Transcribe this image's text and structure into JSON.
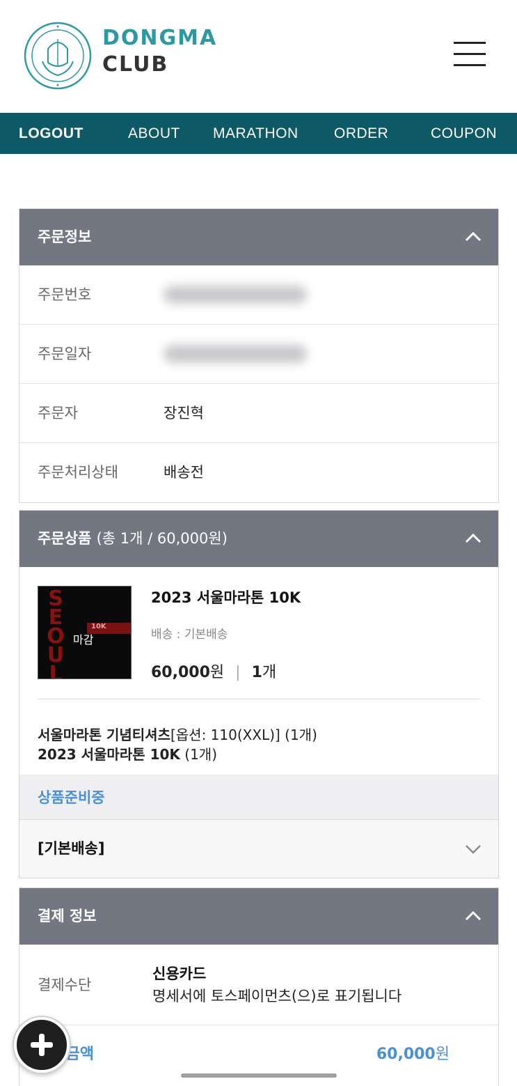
{
  "header": {
    "brand_line1": "DONGMA",
    "brand_line2": "CLUB",
    "logo_icon": "marathon-club-seal",
    "menu_icon": "hamburger-icon"
  },
  "nav": {
    "items": [
      "LOGOUT",
      "ABOUT",
      "MARATHON",
      "ORDER",
      "COUPON"
    ]
  },
  "order_info": {
    "title": "주문정보",
    "rows": [
      {
        "label": "주문번호",
        "value": "",
        "blurred": true
      },
      {
        "label": "주문일자",
        "value": "",
        "blurred": true
      },
      {
        "label": "주문자",
        "value": "장진혁"
      },
      {
        "label": "주문처리상태",
        "value": "배송전"
      }
    ]
  },
  "order_items": {
    "title": "주문상품",
    "subtitle": "(총 1개 / 60,000원)",
    "product": {
      "name": "2023 서울마라톤 10K",
      "shipping": "배송 : 기본배송",
      "price": "60,000",
      "price_unit": "원",
      "qty": "1",
      "qty_unit": "개",
      "thumb_text": "SEOUL",
      "thumb_badge": "10K",
      "thumb_overlay": "마감"
    },
    "options": [
      {
        "name": "서울마라톤 기념티셔츠",
        "detail": "[옵션: 110(XXL)] (1개)"
      },
      {
        "name": "2023 서울마라톤 10K",
        "detail": " (1개)"
      }
    ],
    "status": "상품준비중",
    "shipping_method": "[기본배송]"
  },
  "payment": {
    "title": "결제 정보",
    "method_label": "결제수단",
    "method_value": "신용카드",
    "method_note": "명세서에 토스페이먼츠(으)로 표기됩니다",
    "amount_label": "결제금액",
    "amount_value": "60,000",
    "amount_unit": "원"
  },
  "colors": {
    "nav_bg": "#0d5a66",
    "panel_head_bg": "#737782",
    "accent_blue": "#4a90d9",
    "brand_teal": "#2c9aa0"
  }
}
